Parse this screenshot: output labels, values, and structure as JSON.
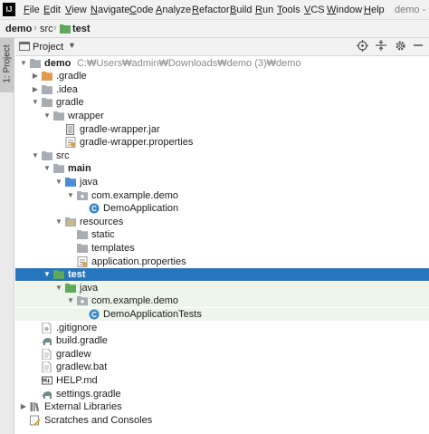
{
  "menubar": {
    "items": [
      "File",
      "Edit",
      "View",
      "Navigate",
      "Code",
      "Analyze",
      "Refactor",
      "Build",
      "Run",
      "Tools",
      "VCS",
      "Window",
      "Help"
    ],
    "title": "demo - C"
  },
  "breadcrumb": {
    "root": "demo",
    "middle": "src",
    "current": "test"
  },
  "side_tab": {
    "label": "1: Project"
  },
  "tool_window": {
    "title": "Project"
  },
  "colors": {
    "selection": "#2675bf",
    "test_tint": "#eef5ea",
    "folder": "#a8adb3",
    "source_folder": "#4e8cd6",
    "test_folder": "#5fa85c",
    "excluded_folder": "#e39a4f",
    "class": "#3a88c9"
  },
  "tree": [
    {
      "label": "demo",
      "path": "C:₩Users₩admin₩Downloads₩demo (3)₩demo",
      "icon": "folder-icon",
      "depth": 0,
      "arrow": "open",
      "bold": true
    },
    {
      "label": ".gradle",
      "icon": "excluded-folder-icon",
      "depth": 1,
      "arrow": "closed"
    },
    {
      "label": ".idea",
      "icon": "folder-icon",
      "depth": 1,
      "arrow": "closed"
    },
    {
      "label": "gradle",
      "icon": "folder-icon",
      "depth": 1,
      "arrow": "open"
    },
    {
      "label": "wrapper",
      "icon": "folder-icon",
      "depth": 2,
      "arrow": "open"
    },
    {
      "label": "gradle-wrapper.jar",
      "icon": "jar-file-icon",
      "depth": 3,
      "arrow": "none"
    },
    {
      "label": "gradle-wrapper.properties",
      "icon": "properties-file-icon",
      "depth": 3,
      "arrow": "none"
    },
    {
      "label": "src",
      "icon": "folder-icon",
      "depth": 1,
      "arrow": "open"
    },
    {
      "label": "main",
      "icon": "folder-icon",
      "depth": 2,
      "arrow": "open",
      "bold": true
    },
    {
      "label": "java",
      "icon": "source-folder-icon",
      "depth": 3,
      "arrow": "open"
    },
    {
      "label": "com.example.demo",
      "icon": "package-icon",
      "depth": 4,
      "arrow": "open"
    },
    {
      "label": "DemoApplication",
      "icon": "class-icon",
      "depth": 5,
      "arrow": "none"
    },
    {
      "label": "resources",
      "icon": "resources-folder-icon",
      "depth": 3,
      "arrow": "open"
    },
    {
      "label": "static",
      "icon": "folder-icon",
      "depth": 4,
      "arrow": "none"
    },
    {
      "label": "templates",
      "icon": "folder-icon",
      "depth": 4,
      "arrow": "none"
    },
    {
      "label": "application.properties",
      "icon": "properties-file-icon",
      "depth": 4,
      "arrow": "none"
    },
    {
      "label": "test",
      "icon": "test-folder-icon",
      "depth": 2,
      "arrow": "open",
      "bold": true,
      "selected": true
    },
    {
      "label": "java",
      "icon": "test-source-folder-icon",
      "depth": 3,
      "arrow": "open",
      "test": true
    },
    {
      "label": "com.example.demo",
      "icon": "package-icon",
      "depth": 4,
      "arrow": "open",
      "test": true
    },
    {
      "label": "DemoApplicationTests",
      "icon": "class-icon",
      "depth": 5,
      "arrow": "none",
      "test": true
    },
    {
      "label": ".gitignore",
      "icon": "gitignore-file-icon",
      "depth": 1,
      "arrow": "none"
    },
    {
      "label": "build.gradle",
      "icon": "gradle-file-icon",
      "depth": 1,
      "arrow": "none"
    },
    {
      "label": "gradlew",
      "icon": "text-file-icon",
      "depth": 1,
      "arrow": "none"
    },
    {
      "label": "gradlew.bat",
      "icon": "text-file-icon",
      "depth": 1,
      "arrow": "none"
    },
    {
      "label": "HELP.md",
      "icon": "markdown-file-icon",
      "depth": 1,
      "arrow": "none"
    },
    {
      "label": "settings.gradle",
      "icon": "gradle-file-icon",
      "depth": 1,
      "arrow": "none"
    },
    {
      "label": "External Libraries",
      "icon": "libraries-icon",
      "depth": 0,
      "arrow": "closed"
    },
    {
      "label": "Scratches and Consoles",
      "icon": "scratches-icon",
      "depth": 0,
      "arrow": "none"
    }
  ]
}
